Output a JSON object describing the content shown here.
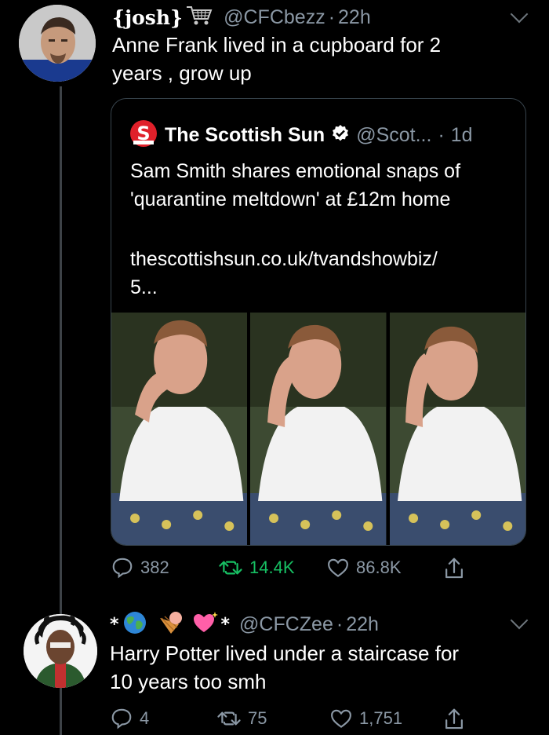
{
  "tweet1": {
    "display_name": "{josh}",
    "name_emoji": "shopping-cart-icon",
    "handle": "@CFCbezz",
    "separator": "·",
    "time": "22h",
    "text_line1": "Anne Frank lived in a cupboard for 2",
    "text_line2": "years , grow up",
    "quoted": {
      "name": "The Scottish Sun",
      "handle": "@Scot...",
      "separator": "·",
      "time": "1d",
      "text_line1": "Sam Smith shares emotional snaps of",
      "text_line2": "'quarantine meltdown' at £12m home",
      "link_line1": "thescottishsun.co.uk/tvandshowbiz/",
      "link_line2": "5..."
    },
    "actions": {
      "replies": "382",
      "retweets": "14.4K",
      "likes": "86.8K"
    }
  },
  "tweet2": {
    "name_prefix": "*",
    "name_suffix": "*",
    "handle": "@CFCZee",
    "separator": "·",
    "time": "22h",
    "text_line1": "Harry Potter lived under a staircase for",
    "text_line2": "10 years too smh",
    "actions": {
      "replies": "4",
      "retweets": "75",
      "likes": "1,751"
    }
  },
  "colors": {
    "background": "#000000",
    "secondary_text": "#8b98a5",
    "retweet_green": "#17bf63",
    "border": "#38444d"
  }
}
